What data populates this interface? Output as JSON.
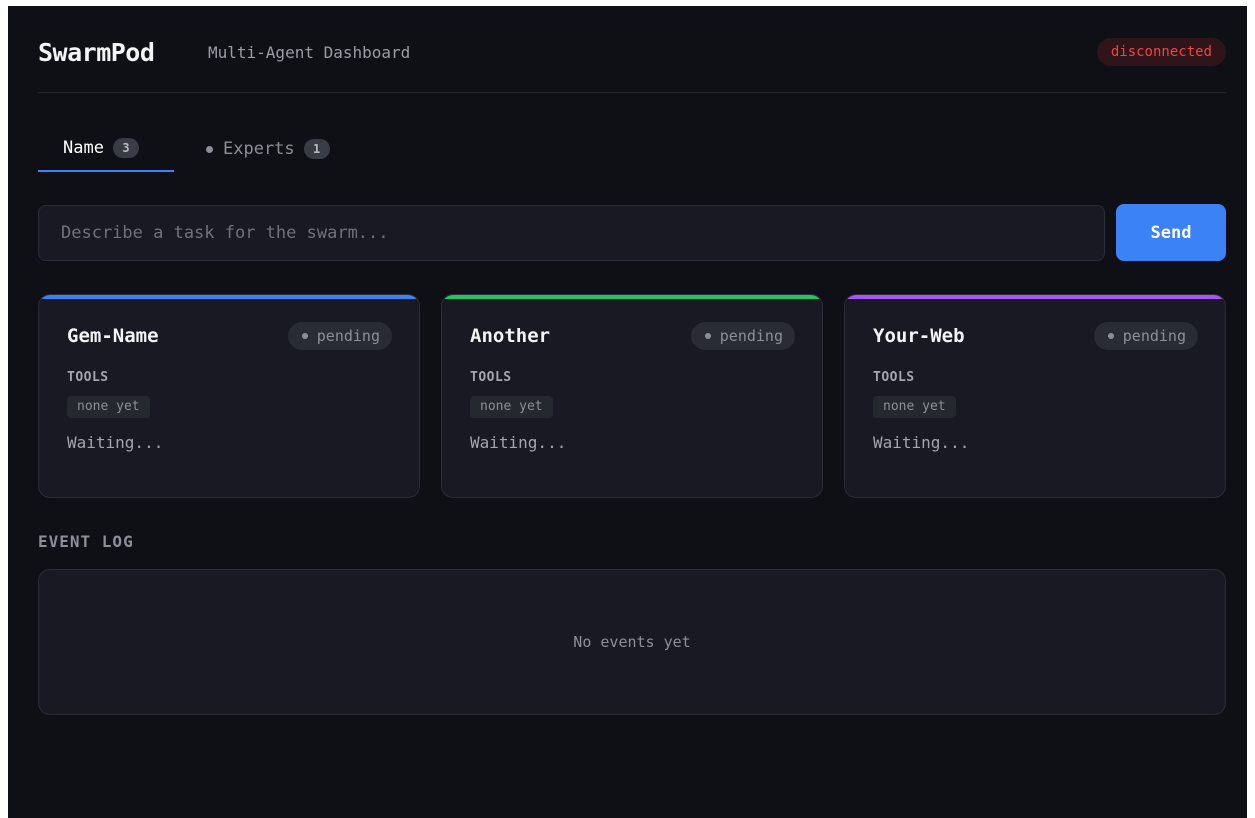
{
  "header": {
    "title": "SwarmPod",
    "subtitle": "Multi-Agent Dashboard",
    "connection_status": "disconnected"
  },
  "tabs": [
    {
      "label": "Name",
      "count": "3",
      "active": true
    },
    {
      "label": "Experts",
      "count": "1",
      "active": false
    }
  ],
  "task": {
    "placeholder": "Describe a task for the swarm...",
    "value": "",
    "send_label": "Send"
  },
  "agents": [
    {
      "name": "Gem-Name",
      "status": "pending",
      "tools_label": "TOOLS",
      "tools": "none yet",
      "output": "Waiting...",
      "accent": "#3b82f6"
    },
    {
      "name": "Another",
      "status": "pending",
      "tools_label": "TOOLS",
      "tools": "none yet",
      "output": "Waiting...",
      "accent": "#22c55e"
    },
    {
      "name": "Your-Web",
      "status": "pending",
      "tools_label": "TOOLS",
      "tools": "none yet",
      "output": "Waiting...",
      "accent": "#a855f7"
    }
  ],
  "event_log": {
    "title": "EVENT LOG",
    "empty_text": "No events yet"
  },
  "colors": {
    "background": "#0f1016",
    "panel": "#181922",
    "primary": "#3b82f6",
    "danger": "#ef4444"
  }
}
